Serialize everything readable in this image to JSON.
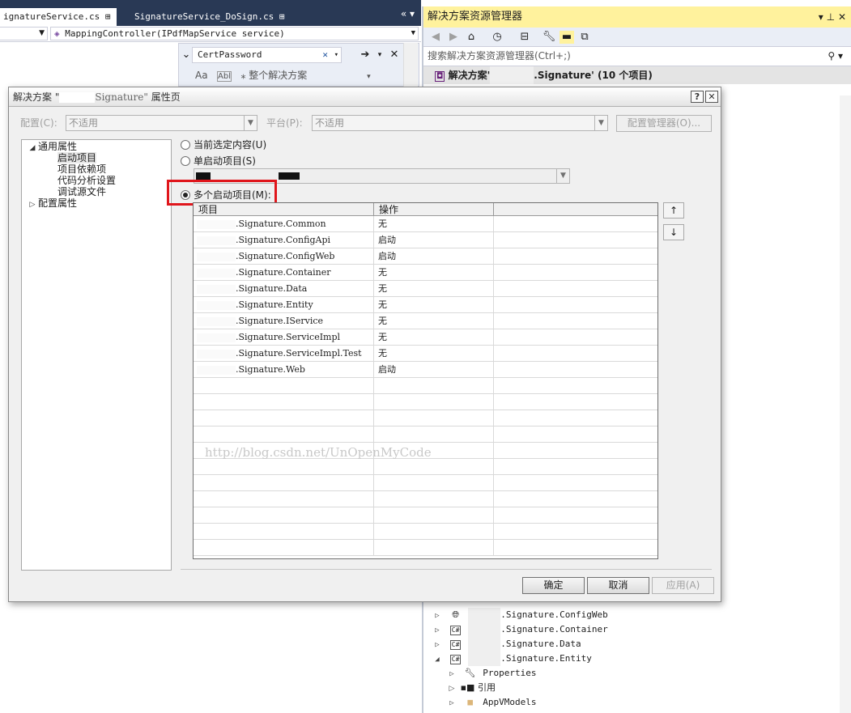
{
  "ide": {
    "doc_tabs": [
      {
        "label": "ignatureService.cs",
        "pin": "⊞"
      },
      {
        "label": "SignatureService_DoSign.cs",
        "pin": "⊞"
      }
    ],
    "nav_member": "MappingController(IPdfMapService service)",
    "find": {
      "value": "CertPassword",
      "scope": "整个解决方案",
      "match_case": "Aa",
      "whole_word": "Abl"
    }
  },
  "solution_explorer": {
    "title": "解决方案资源管理器",
    "search_placeholder": "搜索解决方案资源管理器(Ctrl+;)",
    "root_prefix": "解决方案'",
    "root_suffix": ".Signature' (10 个项目)",
    "items": [
      {
        "name": ".Signature.ConfigWeb",
        "icon": "globe-icon"
      },
      {
        "name": ".Signature.Container",
        "icon": "csharp-project-icon"
      },
      {
        "name": ".Signature.Data",
        "icon": "csharp-project-icon"
      },
      {
        "name": ".Signature.Entity",
        "icon": "csharp-project-icon"
      },
      {
        "name": "Properties",
        "icon": "wrench-icon"
      },
      {
        "name": "引用",
        "icon": "references-icon"
      },
      {
        "name": "AppVModels",
        "icon": "folder-icon"
      }
    ]
  },
  "dialog": {
    "title_prefix": "解决方案 \"",
    "title_mid": "Signature\"",
    "title_suffix": "属性页",
    "help_btn": "?",
    "close_btn": "✕",
    "config_label": "配置(C):",
    "config_value": "不适用",
    "platform_label": "平台(P):",
    "platform_value": "不适用",
    "config_manager": "配置管理器(O)...",
    "tree": {
      "common": "通用属性",
      "startup": "启动项目",
      "deps": "项目依赖项",
      "code_analysis": "代码分析设置",
      "debug_source": "调试源文件",
      "config_props": "配置属性"
    },
    "radio_current": "当前选定内容(U)",
    "radio_single": "单启动项目(S)",
    "radio_multi": "多个启动项目(M):",
    "grid_headers": [
      "项目",
      "操作"
    ],
    "rows": [
      {
        "project": ".Signature.Common",
        "action": "无"
      },
      {
        "project": ".Signature.ConfigApi",
        "action": "启动"
      },
      {
        "project": ".Signature.ConfigWeb",
        "action": "启动"
      },
      {
        "project": ".Signature.Container",
        "action": "无"
      },
      {
        "project": ".Signature.Data",
        "action": "无"
      },
      {
        "project": ".Signature.Entity",
        "action": "无"
      },
      {
        "project": ".Signature.IService",
        "action": "无"
      },
      {
        "project": ".Signature.ServiceImpl",
        "action": "无"
      },
      {
        "project": ".Signature.ServiceImpl.Test",
        "action": "无"
      },
      {
        "project": ".Signature.Web",
        "action": "启动"
      }
    ],
    "watermark": "http://blog.csdn.net/UnOpenMyCode",
    "move_up": "↑",
    "move_down": "↓",
    "ok": "确定",
    "cancel": "取消",
    "apply": "应用(A)"
  }
}
